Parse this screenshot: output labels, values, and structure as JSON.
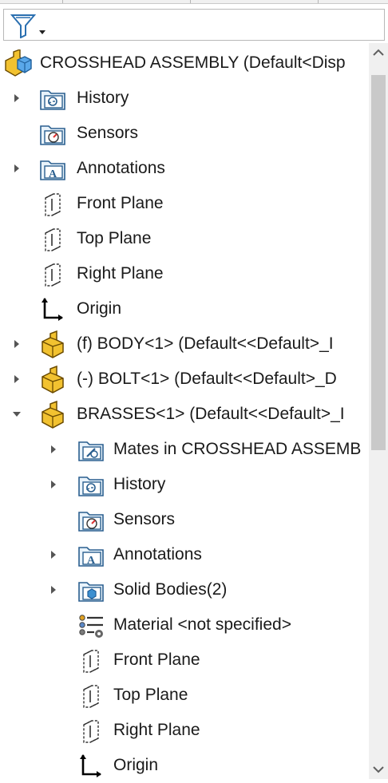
{
  "tree": {
    "root": {
      "label": "CROSSHEAD ASSEMBLY  (Default<Disp",
      "icon": "assembly-icon"
    },
    "items": [
      {
        "label": "History",
        "icon": "history-folder-icon"
      },
      {
        "label": "Sensors",
        "icon": "sensors-folder-icon"
      },
      {
        "label": "Annotations",
        "icon": "annotations-folder-icon"
      },
      {
        "label": "Front Plane",
        "icon": "plane-icon"
      },
      {
        "label": "Top Plane",
        "icon": "plane-icon"
      },
      {
        "label": "Right Plane",
        "icon": "plane-icon"
      },
      {
        "label": "Origin",
        "icon": "origin-icon"
      },
      {
        "label": "(f) BODY<1> (Default<<Default>_I",
        "icon": "part-icon"
      },
      {
        "label": "(-) BOLT<1> (Default<<Default>_D",
        "icon": "part-icon"
      },
      {
        "label": "BRASSES<1> (Default<<Default>_I",
        "icon": "part-icon"
      }
    ],
    "children": [
      {
        "label": "Mates in CROSSHEAD ASSEMB",
        "icon": "mates-folder-icon"
      },
      {
        "label": "History",
        "icon": "history-folder-icon"
      },
      {
        "label": "Sensors",
        "icon": "sensors-folder-icon"
      },
      {
        "label": "Annotations",
        "icon": "annotations-folder-icon"
      },
      {
        "label": "Solid Bodies(2)",
        "icon": "solid-bodies-folder-icon"
      },
      {
        "label": "Material <not specified>",
        "icon": "material-icon"
      },
      {
        "label": "Front Plane",
        "icon": "plane-icon"
      },
      {
        "label": "Top Plane",
        "icon": "plane-icon"
      },
      {
        "label": "Right Plane",
        "icon": "plane-icon"
      },
      {
        "label": "Origin",
        "icon": "origin-icon"
      }
    ]
  },
  "icons": {
    "filter": "filter-icon",
    "collapsed": "expand-arrow-icon",
    "expanded": "collapse-arrow-icon",
    "scroll_up": "scroll-up-icon",
    "scroll_down": "scroll-down-icon"
  },
  "colors": {
    "part_yellow": "#e8b420",
    "folder_blue": "#3b8fd0",
    "assembly_blue": "#2f8fe0"
  }
}
